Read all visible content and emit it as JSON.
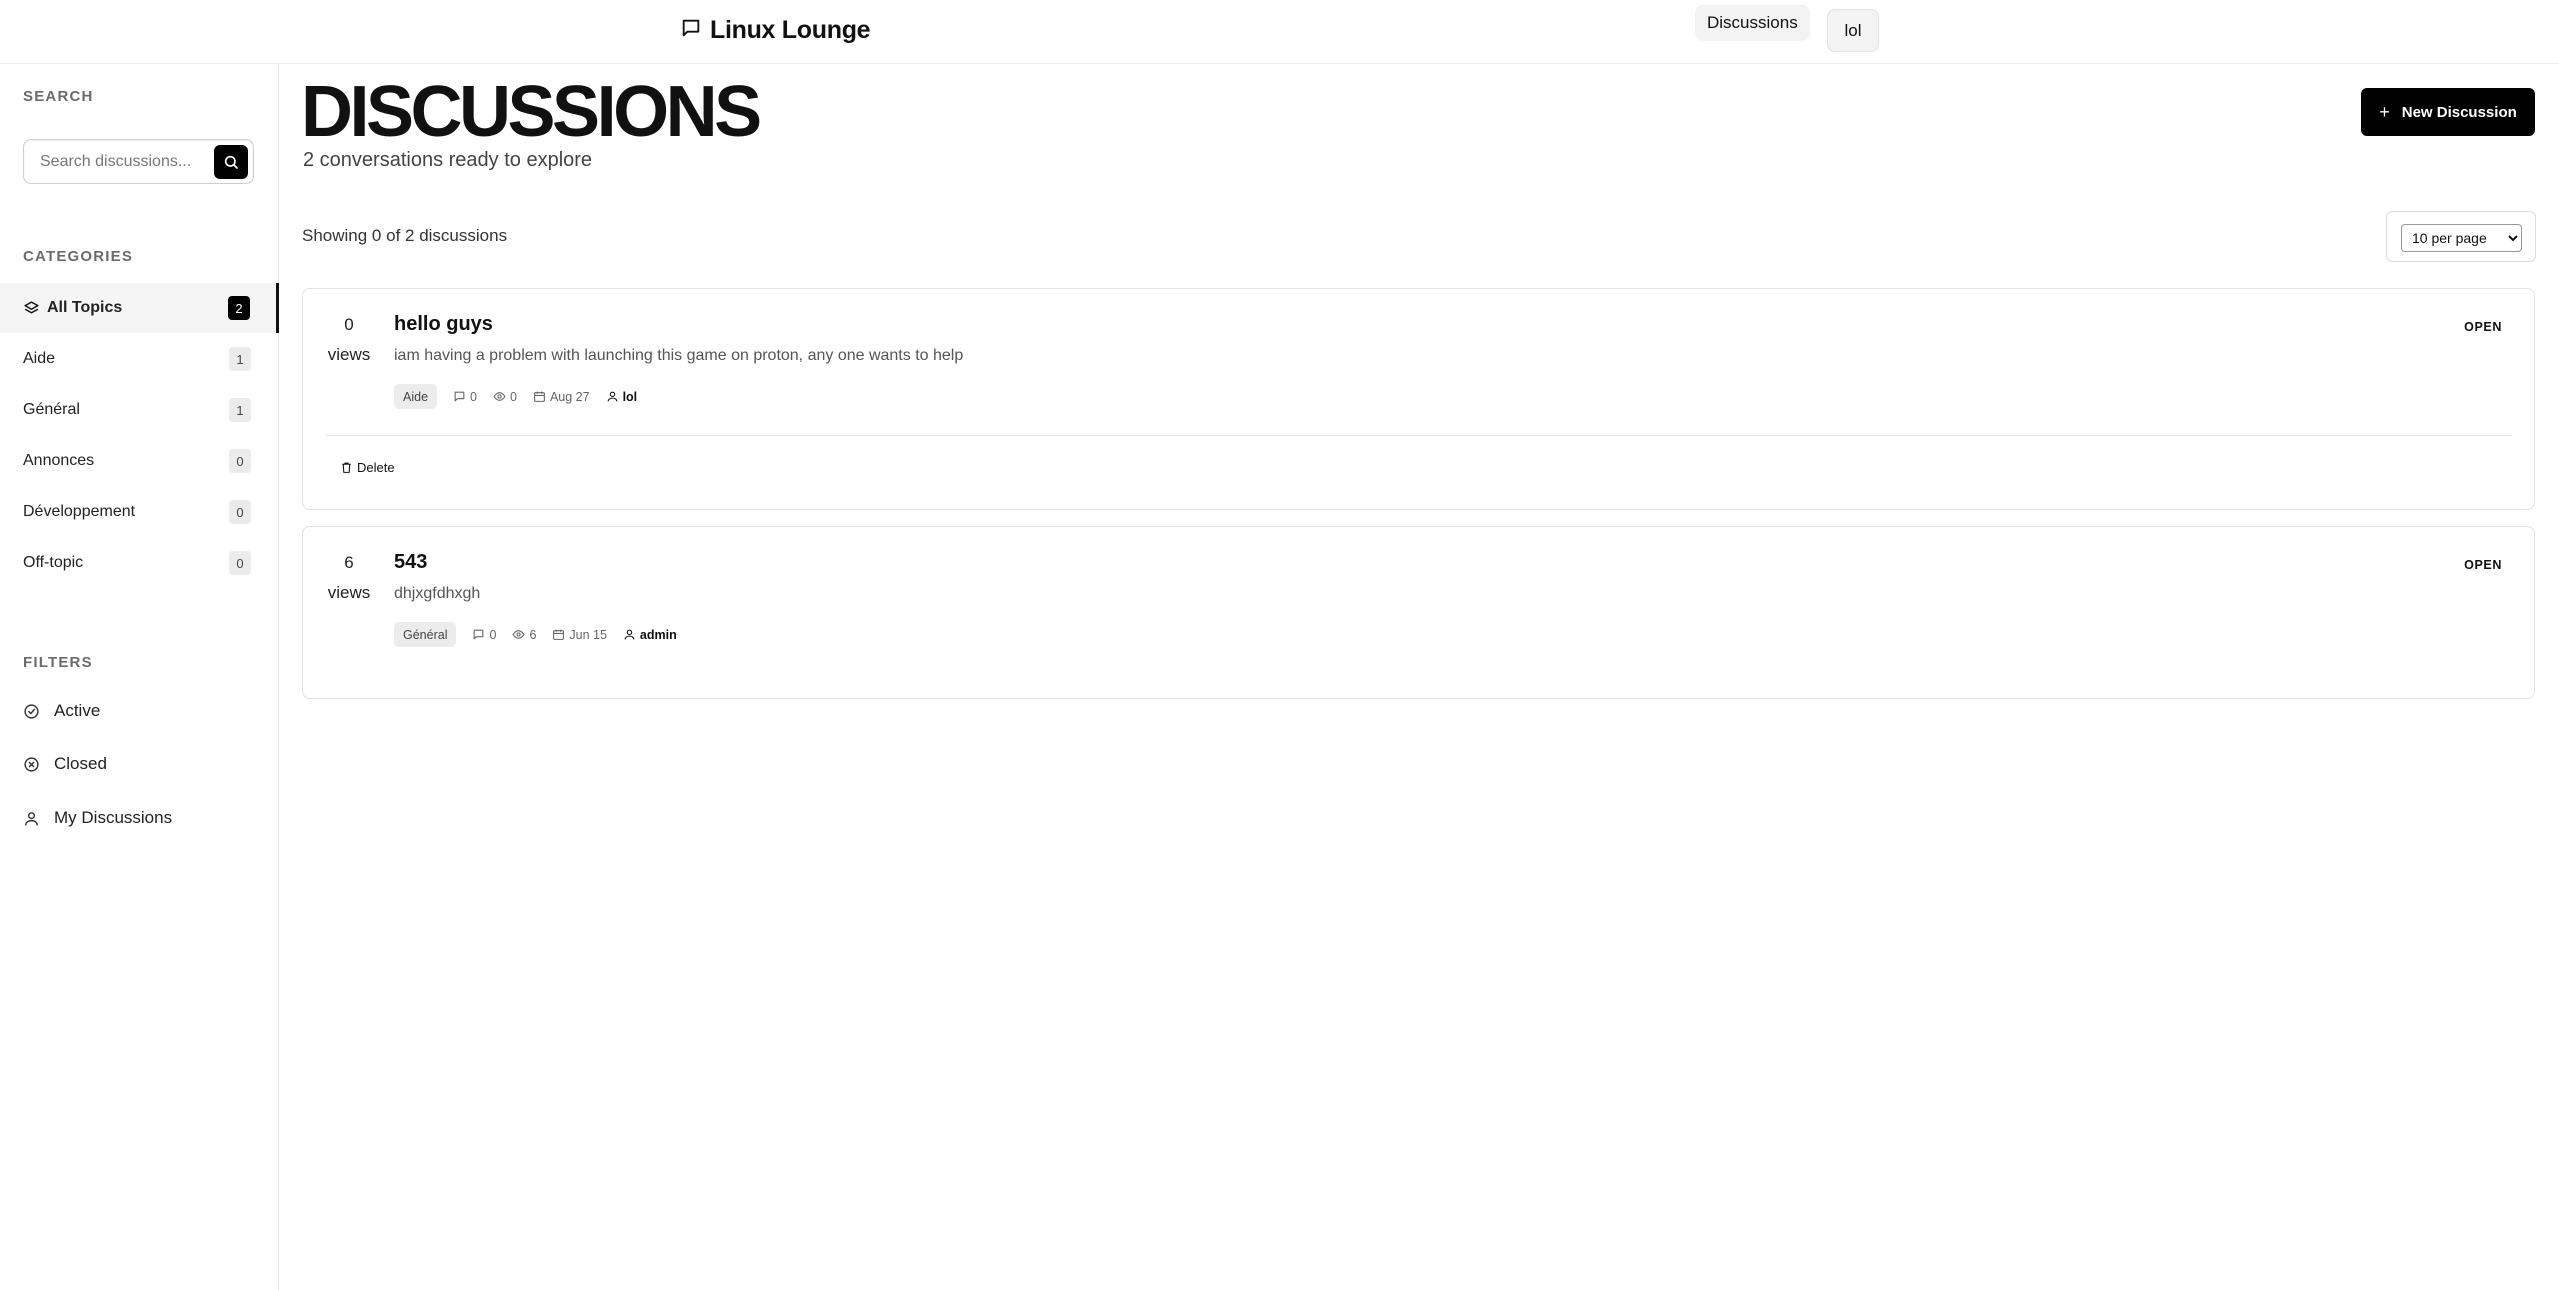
{
  "header": {
    "title": "Linux Lounge",
    "nav_discussions": "Discussions",
    "user_label": "lol"
  },
  "sidebar": {
    "search_heading": "SEARCH",
    "search_placeholder": "Search discussions...",
    "categories_heading": "CATEGORIES",
    "categories": [
      {
        "label": "All Topics",
        "count": "2",
        "active": true
      },
      {
        "label": "Aide",
        "count": "1"
      },
      {
        "label": "Général",
        "count": "1"
      },
      {
        "label": "Annonces",
        "count": "0"
      },
      {
        "label": "Développement",
        "count": "0"
      },
      {
        "label": "Off-topic",
        "count": "0"
      }
    ],
    "filters_heading": "FILTERS",
    "filters": [
      {
        "label": "Active",
        "icon": "check-circle-icon"
      },
      {
        "label": "Closed",
        "icon": "x-circle-icon"
      },
      {
        "label": "My Discussions",
        "icon": "user-icon"
      }
    ]
  },
  "main": {
    "title": "DISCUSSIONS",
    "subtitle": "2 conversations ready to explore",
    "new_button": "New Discussion",
    "showing": "Showing 0 of 2 discussions",
    "per_page": "10 per page",
    "per_page_options": [
      "10 per page"
    ]
  },
  "discussions": [
    {
      "views": "0",
      "views_label": "views",
      "title": "hello guys",
      "excerpt": "iam having a problem with launching this game on proton, any one wants to help",
      "category": "Aide",
      "comments": "0",
      "view_count": "0",
      "date": "Aug 27",
      "author": "lol",
      "status": "OPEN",
      "delete_label": "Delete"
    },
    {
      "views": "6",
      "views_label": "views",
      "title": "543",
      "excerpt": "dhjxgfdhxgh",
      "category": "Général",
      "comments": "0",
      "view_count": "6",
      "date": "Jun 15",
      "author": "admin",
      "status": "OPEN"
    }
  ],
  "colors": {
    "accent": "#000000",
    "border": "#e3e3e3",
    "badge_bg": "#ebebeb"
  }
}
